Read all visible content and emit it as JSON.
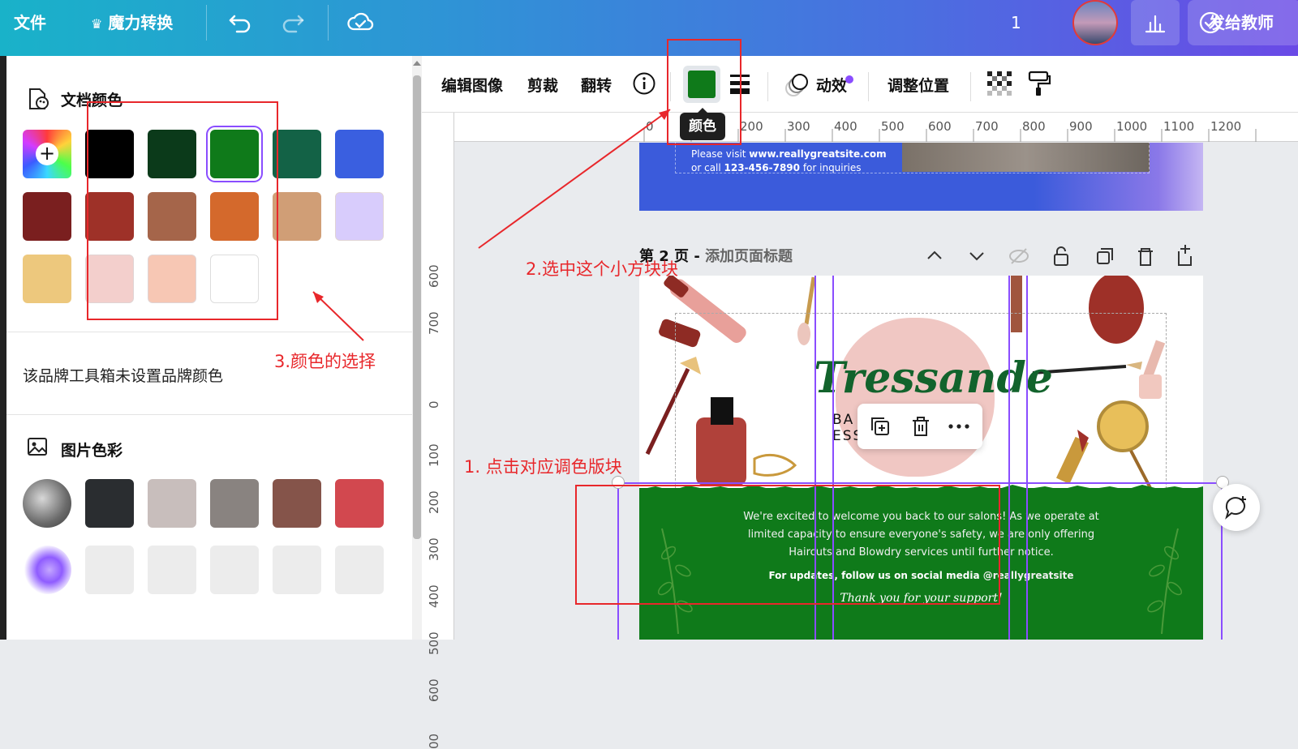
{
  "topbar": {
    "file": "文件",
    "magic": "魔力转换",
    "page_count": "1",
    "share": "发给教师"
  },
  "left_panel": {
    "doc_colors_title": "文档颜色",
    "doc_colors": [
      "#000000",
      "#0b3a1a",
      "#0f7a1a",
      "#136246",
      "#3a5fe0",
      "#7a1f1f",
      "#9e3128",
      "#a5654a",
      "#d4692c",
      "#d09e76",
      "#d8ccfc",
      "#edc87d",
      "#f3cfcc",
      "#f7c7b4",
      "#ffffff"
    ],
    "brand_note": "该品牌工具箱未设置品牌颜色",
    "image_colors_title": "图片色彩",
    "image_colors": [
      "#2a2d30",
      "#c8bebc",
      "#898380",
      "#85544a",
      "#d2484f"
    ]
  },
  "toolbar": {
    "edit_image": "编辑图像",
    "crop": "剪裁",
    "flip": "翻转",
    "color_tooltip": "颜色",
    "animate": "动效",
    "position": "调整位置",
    "current_color": "#0f7a1a"
  },
  "ruler": {
    "top_labels": [
      "0",
      "200",
      "300",
      "400",
      "500",
      "600",
      "700",
      "800",
      "900",
      "1000",
      "1100",
      "1200"
    ],
    "left_labels": [
      "600",
      "700",
      "0",
      "100",
      "200",
      "300",
      "400",
      "500",
      "600",
      "00"
    ]
  },
  "canvas": {
    "page1_line1_pre": "Please visit ",
    "page1_site": "www.reallygreatsite.com",
    "page1_line2_pre": "or call ",
    "page1_phone": "123-456-7890",
    "page1_line2_post": " for inquiries",
    "page2_label": "第 2 页 - ",
    "page2_title": "添加页面标题",
    "brand": "Tressande",
    "brand_sub_left": "BA",
    "brand_sub_right": "ESS",
    "green_p1": "We're excited to welcome you back to our salons! As we operate at",
    "green_p2": "limited capacity to ensure everyone's safety, we are only offering",
    "green_p3": "Haircuts and Blowdry services until further notice.",
    "green_p4_pre": "For updates, follow us on social media ",
    "green_handle": "@reallygreatsite",
    "thanks": "Thank you for your support!"
  },
  "annotations": {
    "step1": "1. 点击对应调色版块",
    "step2": "2.选中这个小方块块",
    "step3": "3.颜色的选择"
  }
}
